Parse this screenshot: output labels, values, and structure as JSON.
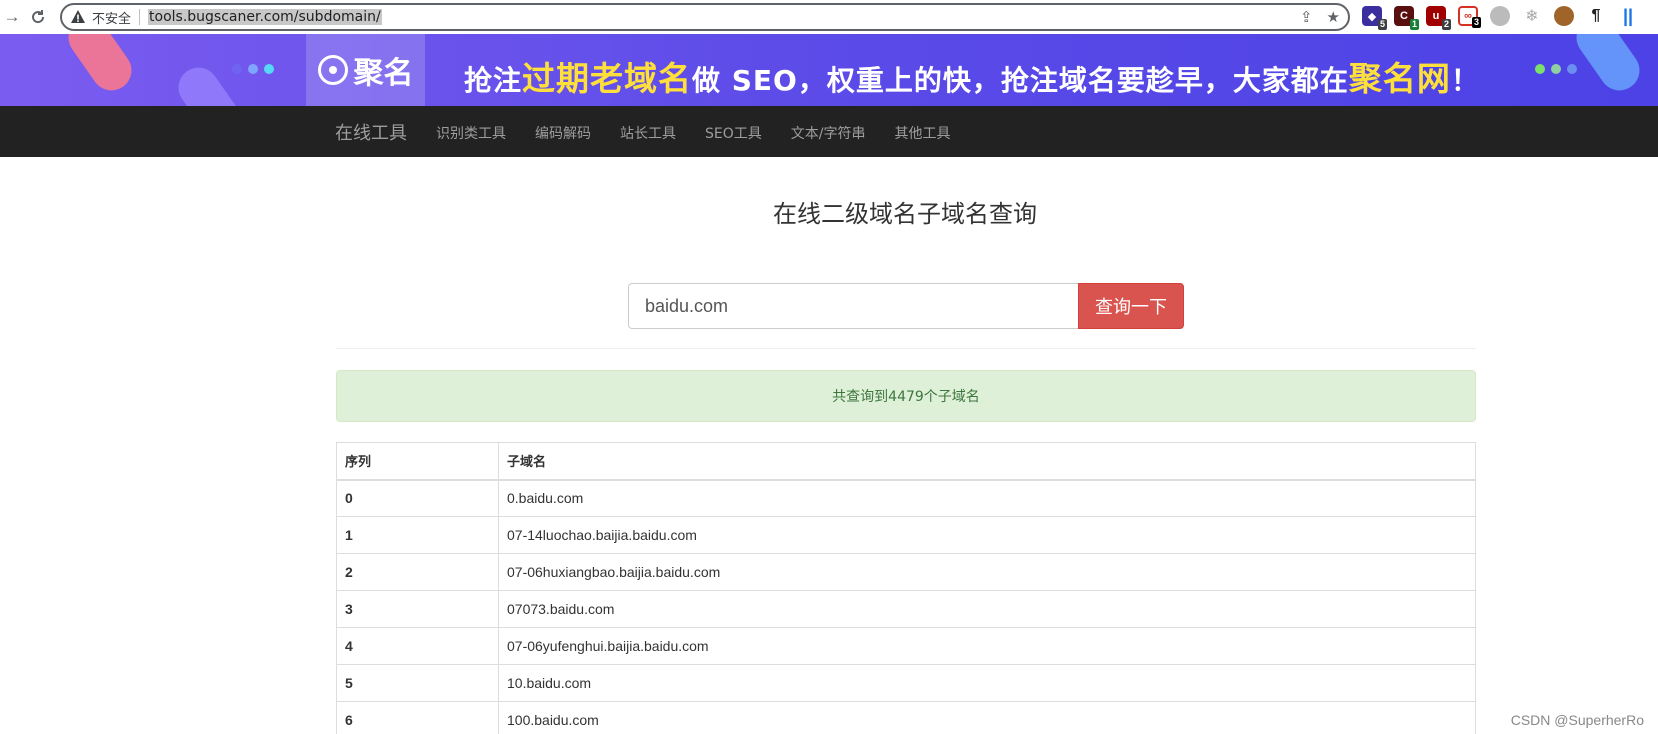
{
  "browser": {
    "insecure_label": "不安全",
    "url": "tools.bugscaner.com/subdomain/",
    "extensions": [
      {
        "name": "ext-1",
        "color": "#3b2fa0",
        "badge": "5"
      },
      {
        "name": "ext-2",
        "color": "#8b0000",
        "badge": "1"
      },
      {
        "name": "ext-3",
        "color": "#a00000",
        "badge": "2"
      },
      {
        "name": "ext-4",
        "color": "#d93025",
        "badge": "3"
      }
    ]
  },
  "banner": {
    "logo": "聚名",
    "slogan_part1": "抢注",
    "slogan_hl1": "过期老域名",
    "slogan_part2": "做 SEO，权重上的快，抢注域名要趁早，大家都在",
    "slogan_hl2": "聚名网",
    "slogan_end": "！"
  },
  "navbar": {
    "brand": "在线工具",
    "links": [
      "识别类工具",
      "编码解码",
      "站长工具",
      "SEO工具",
      "文本/字符串",
      "其他工具"
    ]
  },
  "main": {
    "title": "在线二级域名子域名查询",
    "search_value": "baidu.com",
    "search_button": "查询一下",
    "result_summary": "共查询到4479个子域名"
  },
  "table": {
    "headers": [
      "序列",
      "子域名"
    ],
    "rows": [
      [
        "0",
        "0.baidu.com"
      ],
      [
        "1",
        "07-14luochao.baijia.baidu.com"
      ],
      [
        "2",
        "07-06huxiangbao.baijia.baidu.com"
      ],
      [
        "3",
        "07073.baidu.com"
      ],
      [
        "4",
        "07-06yufenghui.baijia.baidu.com"
      ],
      [
        "5",
        "10.baidu.com"
      ],
      [
        "6",
        "100.baidu.com"
      ]
    ]
  },
  "watermark": "CSDN @SuperherRo",
  "colors": {
    "navbar_bg": "#222222",
    "search_button": "#d9534f",
    "alert_bg": "#dff0d8",
    "banner_accent": "#ffe03a"
  }
}
